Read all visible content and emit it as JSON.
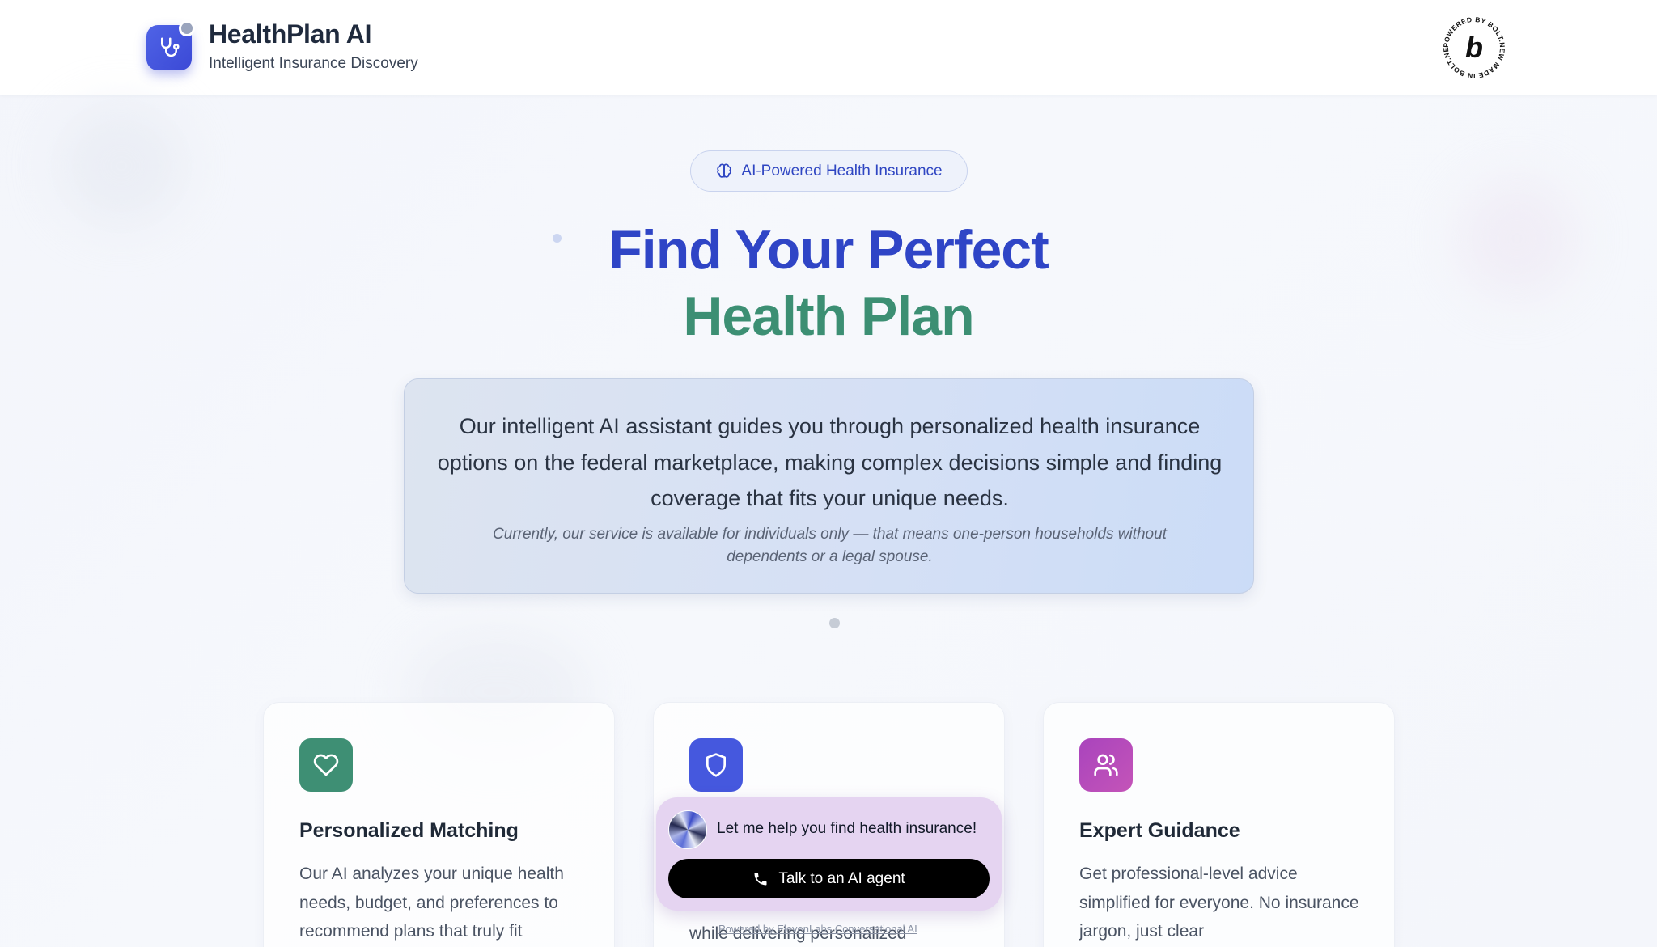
{
  "header": {
    "brand_name": "HealthPlan AI",
    "brand_subtitle": "Intelligent Insurance Discovery",
    "badge_text": "POWERED BY BOLT.NEW MADE IN BOLT.NEW",
    "badge_letter": "b"
  },
  "hero": {
    "pill_label": "AI-Powered Health Insurance",
    "title_line1": "Find Your Perfect",
    "title_line2": "Health Plan",
    "description": "Our intelligent AI assistant guides you through personalized health insurance options on the federal marketplace, making complex decisions simple and finding coverage that fits your unique needs.",
    "note": "Currently, our service is available for individuals only — that means one-person households without dependents or a legal spouse."
  },
  "features": [
    {
      "icon": "heart-icon",
      "title": "Personalized Matching",
      "body": "Our AI analyzes your unique health needs, budget, and preferences to recommend plans that truly fit"
    },
    {
      "icon": "shield-icon",
      "title": "",
      "body": "while delivering personalized"
    },
    {
      "icon": "users-icon",
      "title": "Expert Guidance",
      "body": "Get professional-level advice simplified for everyone. No insurance jargon, just clear"
    }
  ],
  "widget": {
    "prompt": "Let me help you find health insurance!",
    "button_label": "Talk to an AI agent",
    "powered_by": "Powered by ElevenLabs Conversational AI"
  },
  "colors": {
    "brand_blue": "#2f45c6",
    "brand_green": "#3c8f73",
    "heart_tile": "#3e8f74",
    "shield_tile": "#4558de",
    "users_tile": "#b04bc0"
  }
}
